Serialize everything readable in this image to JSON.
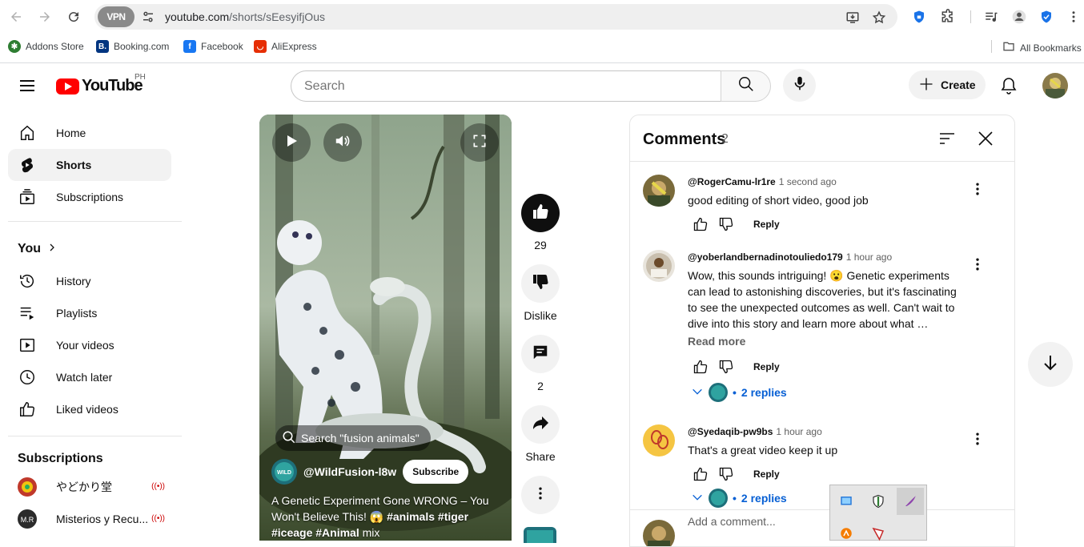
{
  "browser": {
    "vpn_label": "VPN",
    "url_domain": "youtube.com",
    "url_path": "/shorts/sEesyifjOus",
    "bookmarks": [
      {
        "label": "Addons Store",
        "color": "#2e7d32"
      },
      {
        "label": "Booking.com",
        "color": "#003580"
      },
      {
        "label": "Facebook",
        "color": "#1877f2"
      },
      {
        "label": "AliExpress",
        "color": "#e62e04"
      }
    ],
    "all_bookmarks": "All Bookmarks"
  },
  "masthead": {
    "logo_text": "YouTube",
    "region": "PH",
    "search_placeholder": "Search",
    "create_label": "Create"
  },
  "sidebar": {
    "main": [
      {
        "label": "Home",
        "icon": "home-icon"
      },
      {
        "label": "Shorts",
        "icon": "shorts-icon",
        "active": true
      },
      {
        "label": "Subscriptions",
        "icon": "subscriptions-icon"
      }
    ],
    "you_heading": "You",
    "you_items": [
      {
        "label": "History",
        "icon": "history-icon"
      },
      {
        "label": "Playlists",
        "icon": "playlists-icon"
      },
      {
        "label": "Your videos",
        "icon": "your-videos-icon"
      },
      {
        "label": "Watch later",
        "icon": "watch-later-icon"
      },
      {
        "label": "Liked videos",
        "icon": "liked-videos-icon"
      }
    ],
    "subscriptions_heading": "Subscriptions",
    "subscriptions": [
      {
        "label": "やどかり堂",
        "live": true
      },
      {
        "label": "Misterios y Recu...",
        "live": true
      }
    ]
  },
  "short": {
    "search_suggestion": "Search \"fusion animals\"",
    "channel": "@WildFusion-l8w",
    "subscribe_label": "Subscribe",
    "title_plain": "A Genetic Experiment Gone WRONG – You Won't Believe This! 😱 ",
    "hashtags": [
      "#animals",
      "#tiger",
      "#iceage",
      "#Animal"
    ],
    "title_suffix": " mix"
  },
  "actions": {
    "likes": "29",
    "dislike_label": "Dislike",
    "comments": "2",
    "share_label": "Share"
  },
  "comments": {
    "title": "Comments",
    "count": "2",
    "items": [
      {
        "author": "@RogerCamu-lr1re",
        "time": "1 second ago",
        "text": "good editing of short video, good job",
        "reply_label": "Reply"
      },
      {
        "author": "@yoberlandbernadinotouliedo179",
        "time": "1 hour ago",
        "text": "Wow, this sounds intriguing! 😮 Genetic experiments can lead to astonishing discoveries, but it's fascinating to see the unexpected outcomes as well. Can't wait to dive into this story and learn more about what …",
        "read_more": "Read more",
        "reply_label": "Reply",
        "replies": "2 replies"
      },
      {
        "author": "@Syedaqib-pw9bs",
        "time": "1 hour ago",
        "text": "That's a great video keep it up",
        "reply_label": "Reply",
        "replies": "2 replies"
      }
    ],
    "add_placeholder": "Add a comment..."
  },
  "colors": {
    "yt_red": "#ff0000",
    "link_blue": "#065fd4",
    "chip_bg": "#f2f2f2"
  }
}
